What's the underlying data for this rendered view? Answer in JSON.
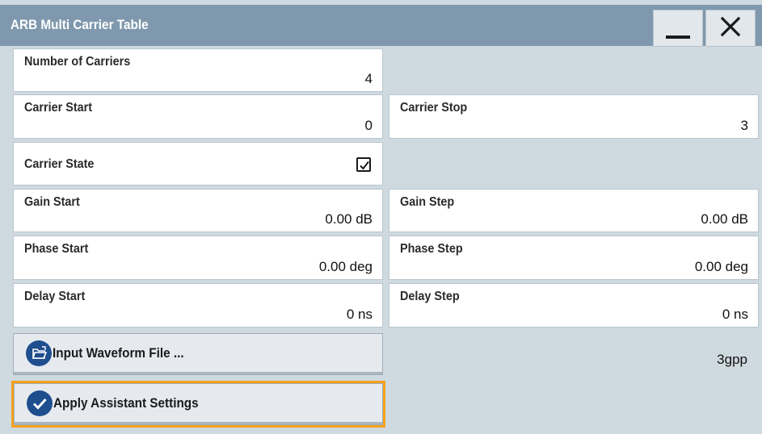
{
  "window": {
    "title": "ARB Multi Carrier Table",
    "minimize_icon": "minimize-icon",
    "close_icon": "close-icon"
  },
  "fields": {
    "number_of_carriers": {
      "label": "Number of Carriers",
      "value": "4"
    },
    "carrier_start": {
      "label": "Carrier Start",
      "value": "0"
    },
    "carrier_stop": {
      "label": "Carrier Stop",
      "value": "3"
    },
    "carrier_state": {
      "label": "Carrier State",
      "checked": true
    },
    "gain_start": {
      "label": "Gain Start",
      "value": "0.00 dB"
    },
    "gain_step": {
      "label": "Gain Step",
      "value": "0.00 dB"
    },
    "phase_start": {
      "label": "Phase Start",
      "value": "0.00 deg"
    },
    "phase_step": {
      "label": "Phase Step",
      "value": "0.00 deg"
    },
    "delay_start": {
      "label": "Delay Start",
      "value": "0 ns"
    },
    "delay_step": {
      "label": "Delay Step",
      "value": "0 ns"
    }
  },
  "buttons": {
    "input_waveform": {
      "label": "Input Waveform File ...",
      "icon": "folder-open-icon"
    },
    "apply_assistant": {
      "label": "Apply Assistant Settings",
      "icon": "checkmark-icon"
    }
  },
  "waveform_file_name": "3gpp",
  "colors": {
    "titlebar": "#7f98ad",
    "panel": "#cfd9e0",
    "icon_blue": "#1f4e8f",
    "focus": "#f5a21c"
  }
}
